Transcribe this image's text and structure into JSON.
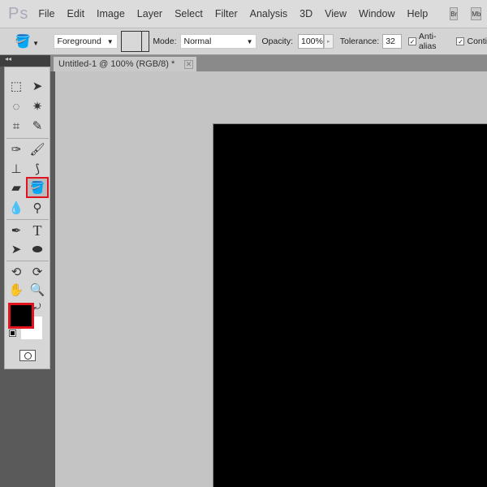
{
  "menubar": {
    "logo": "Ps",
    "items": [
      "File",
      "Edit",
      "Image",
      "Layer",
      "Select",
      "Filter",
      "Analysis",
      "3D",
      "View",
      "Window",
      "Help"
    ],
    "bridge": "Br",
    "minibridge": "Mb"
  },
  "options": {
    "tool_icon": "paint-bucket-icon",
    "fill_source": "Foreground",
    "mode_label": "Mode:",
    "mode": "Normal",
    "opacity_label": "Opacity:",
    "opacity": "100%",
    "tolerance_label": "Tolerance:",
    "tolerance": "32",
    "antialias_label": "Anti-alias",
    "antialias": true,
    "contiguous_label": "Conti",
    "contiguous": true
  },
  "panel": {
    "collapse": "◂◂"
  },
  "document": {
    "tab": "Untitled-1 @ 100% (RGB/8) *",
    "close": "✕",
    "canvas_color": "#000000"
  },
  "tools": {
    "active": "paint-bucket",
    "foreground_color": "#000000",
    "background_color": "#ffffff",
    "highlight_color": "#e0141e"
  }
}
